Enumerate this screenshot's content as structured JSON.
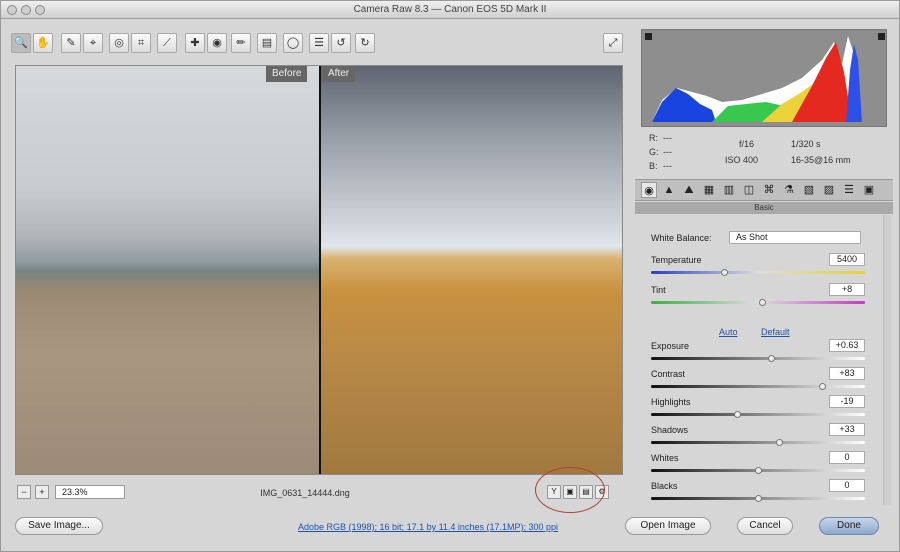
{
  "window": {
    "title": "Camera Raw 8.3 — Canon EOS 5D Mark II"
  },
  "toolbar": {
    "tools": [
      {
        "name": "zoom-tool",
        "glyph": "🔍"
      },
      {
        "name": "hand-tool",
        "glyph": "✋"
      },
      {
        "name": "white-balance-tool",
        "glyph": "✎"
      },
      {
        "name": "color-sampler-tool",
        "glyph": "⌖"
      },
      {
        "name": "targeted-adjustment-tool",
        "glyph": "◎"
      },
      {
        "name": "crop-tool",
        "glyph": "⌗"
      },
      {
        "name": "straighten-tool",
        "glyph": "⟋"
      },
      {
        "name": "spot-removal-tool",
        "glyph": "✚"
      },
      {
        "name": "red-eye-tool",
        "glyph": "◉"
      },
      {
        "name": "adjustment-brush-tool",
        "glyph": "✏"
      },
      {
        "name": "graduated-filter-tool",
        "glyph": "▤"
      },
      {
        "name": "radial-filter-tool",
        "glyph": "◯"
      },
      {
        "name": "preferences-tool",
        "glyph": "☰"
      },
      {
        "name": "rotate-ccw-tool",
        "glyph": "↺"
      },
      {
        "name": "rotate-cw-tool",
        "glyph": "↻"
      }
    ],
    "fullscreen_glyph": "⤢"
  },
  "preview": {
    "before_label": "Before",
    "after_label": "After"
  },
  "statusbar": {
    "zoom": "23.3%",
    "filename": "IMG_0631_14444.dng",
    "view_buttons": [
      "Y",
      "▣",
      "▤",
      "⚙"
    ]
  },
  "info": {
    "r_label": "R:",
    "g_label": "G:",
    "b_label": "B:",
    "r_val": "---",
    "g_val": "---",
    "b_val": "---",
    "aperture": "f/16",
    "shutter": "1/320 s",
    "iso": "ISO 400",
    "lens": "16-35@16 mm"
  },
  "panel": {
    "title": "Basic",
    "tabs": [
      "◉",
      "▲",
      "⛰",
      "▦",
      "▥",
      "◫",
      "⌘",
      "⚗",
      "▧",
      "▨",
      "☰",
      "▣"
    ],
    "white_balance_label": "White Balance:",
    "white_balance_value": "As Shot",
    "sliders": [
      {
        "label": "Temperature",
        "value": "5400",
        "fraction": 0.34,
        "gradient": "linear-gradient(to right,#2a3fc0,#ddd,#e6d23a)"
      },
      {
        "label": "Tint",
        "value": "+8",
        "fraction": 0.52,
        "gradient": "linear-gradient(to right,#38b043,#ddd,#c03cc0)"
      },
      {
        "label": "Exposure",
        "value": "+0.63",
        "fraction": 0.56,
        "gradient": "linear-gradient(to right,#111,#fff)"
      },
      {
        "label": "Contrast",
        "value": "+83",
        "fraction": 0.8,
        "gradient": "linear-gradient(to right,#111,#fff)"
      },
      {
        "label": "Highlights",
        "value": "-19",
        "fraction": 0.4,
        "gradient": "linear-gradient(to right,#111,#fff)"
      },
      {
        "label": "Shadows",
        "value": "+33",
        "fraction": 0.6,
        "gradient": "linear-gradient(to right,#111,#fff)"
      },
      {
        "label": "Whites",
        "value": "0",
        "fraction": 0.5,
        "gradient": "linear-gradient(to right,#111,#fff)"
      },
      {
        "label": "Blacks",
        "value": "0",
        "fraction": 0.5,
        "gradient": "linear-gradient(to right,#111,#fff)"
      }
    ],
    "auto_label": "Auto",
    "default_label": "Default"
  },
  "bottom": {
    "save_label": "Save Image...",
    "workflow_link": "Adobe RGB (1998); 16 bit; 17.1 by 11.4 inches (17.1MP); 300 ppi",
    "open_label": "Open Image",
    "cancel_label": "Cancel",
    "done_label": "Done"
  }
}
